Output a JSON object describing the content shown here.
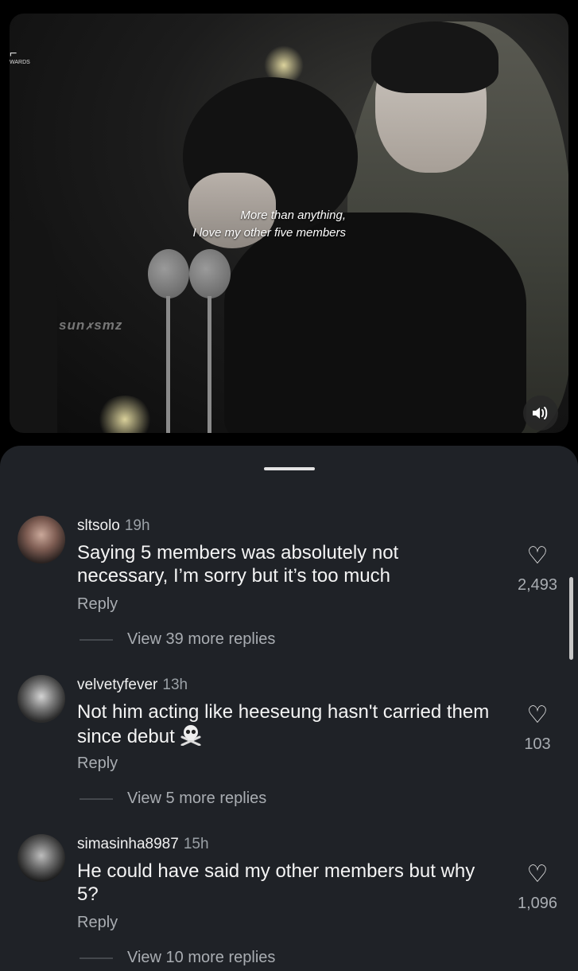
{
  "video": {
    "caption_line1": "More than anything,",
    "caption_line2": "I love my other five members",
    "watermark_1": "sun",
    "watermark_2": "smz",
    "corner_logo_text": "WARDS",
    "sound_icon": "speaker-icon"
  },
  "comments": [
    {
      "username": "sltsolo",
      "time": "19h",
      "text": "Saying 5 members was absolutely not necessary, I’m sorry but it’s too much",
      "reply_label": "Reply",
      "likes": "2,493",
      "view_more": "View 39 more replies"
    },
    {
      "username": "velvetyfever",
      "time": "13h",
      "text": "Not him acting like heeseung hasn't carried them since debut",
      "emoji": "skull-and-crossbones-icon",
      "reply_label": "Reply",
      "likes": "103",
      "view_more": "View 5 more replies"
    },
    {
      "username": "simasinha8987",
      "time": "15h",
      "text": "He could have said my other members but why 5?",
      "reply_label": "Reply",
      "likes": "1,096",
      "view_more": "View 10 more replies"
    }
  ],
  "colors": {
    "sheet_bg": "#1f2227",
    "muted": "#a9adb2"
  }
}
